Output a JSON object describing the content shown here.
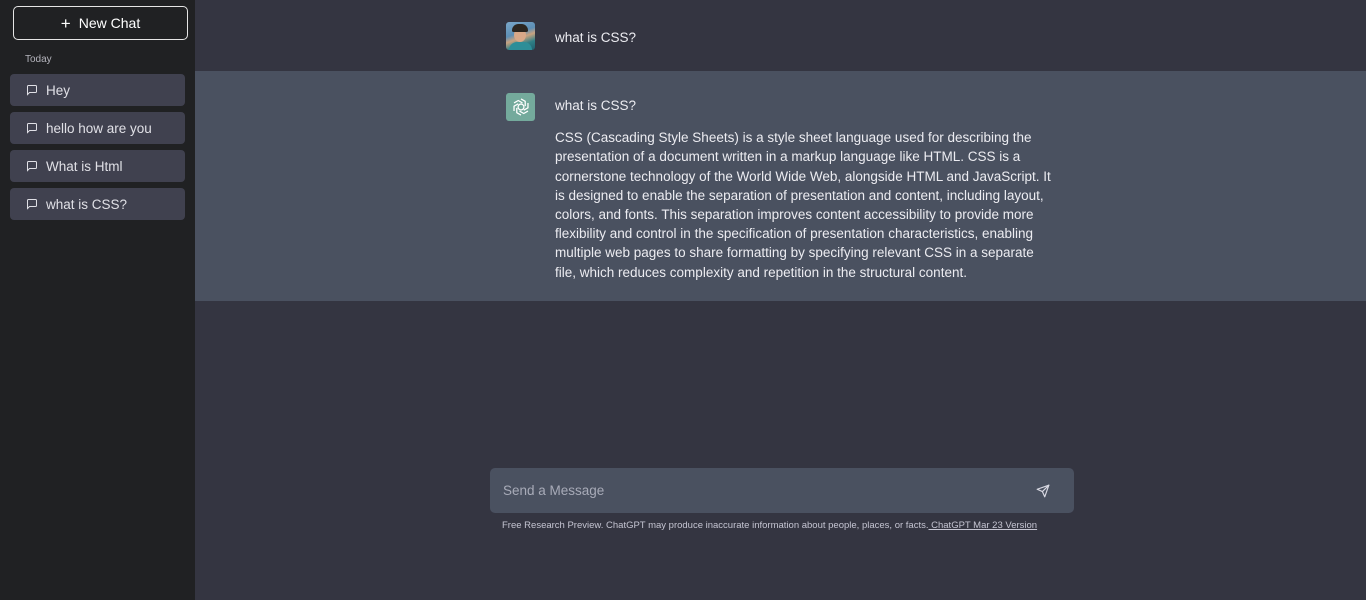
{
  "sidebar": {
    "new_chat_label": "New Chat",
    "section_label": "Today",
    "chats": [
      {
        "label": "Hey"
      },
      {
        "label": "hello how are you"
      },
      {
        "label": "What is Html"
      },
      {
        "label": "what is CSS?"
      }
    ]
  },
  "conversation": {
    "user_message": "what is CSS?",
    "bot_question_echo": "what is CSS?",
    "bot_answer": "CSS (Cascading Style Sheets) is a style sheet language used for describing the presentation of a document written in a markup language like HTML. CSS is a cornerstone technology of the World Wide Web, alongside HTML and JavaScript. It is designed to enable the separation of presentation and content, including layout, colors, and fonts. This separation improves content accessibility to provide more flexibility and control in the specification of presentation characteristics, enabling multiple web pages to share formatting by specifying relevant CSS in a separate file, which reduces complexity and repetition in the structural content."
  },
  "composer": {
    "placeholder": "Send a Message",
    "value": ""
  },
  "footer": {
    "disclaimer": "Free Research Preview. ChatGPT may produce inaccurate information about people, places, or facts.",
    "version_link": " ChatGPT Mar 23 Version"
  },
  "colors": {
    "sidebar_bg": "#202123",
    "main_bg": "#343541",
    "bot_row_bg": "#4a5160",
    "chat_item_bg": "#40414f",
    "bot_avatar_bg": "#74aa9c"
  }
}
